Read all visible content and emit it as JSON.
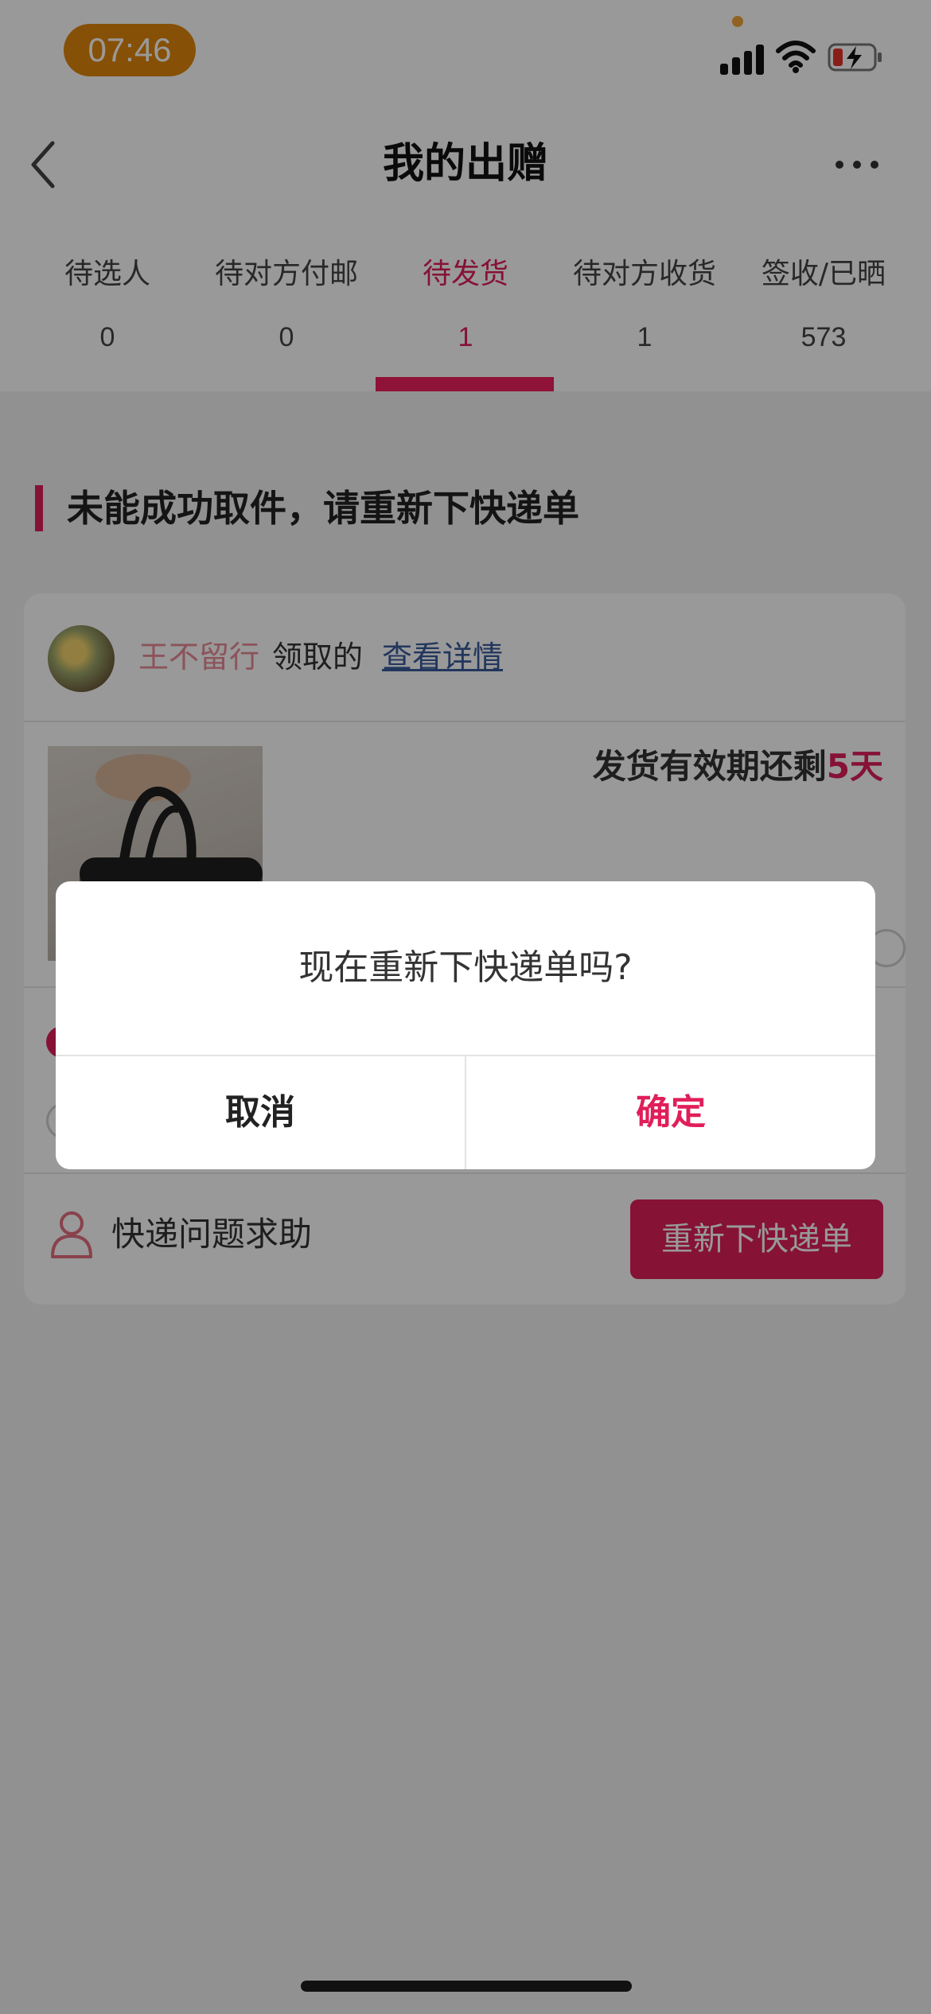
{
  "status_bar": {
    "time": "07:46",
    "icons": [
      "signal-icon",
      "wifi-icon",
      "battery-charging-icon"
    ]
  },
  "header": {
    "title": "我的出赠",
    "back_icon": "chevron-left-icon",
    "more_icon": "more-horizontal-icon"
  },
  "tabs": [
    {
      "label": "待选人",
      "count": "0",
      "active": false
    },
    {
      "label": "待对方付邮",
      "count": "0",
      "active": false
    },
    {
      "label": "待发货",
      "count": "1",
      "active": true
    },
    {
      "label": "待对方收货",
      "count": "1",
      "active": false
    },
    {
      "label": "签收/已晒",
      "count": "573",
      "active": false
    }
  ],
  "section": {
    "title": "未能成功取件，请重新下快递单"
  },
  "card": {
    "giver_name": "王不留行",
    "receive_text": "领取的",
    "detail_link": "查看详情",
    "deadline_prefix": "发货有效期还剩",
    "deadline_days": "5天",
    "help_text": "快递问题求助",
    "reorder_button": "重新下快递单"
  },
  "dialog": {
    "message": "现在重新下快递单吗?",
    "cancel": "取消",
    "confirm": "确定"
  },
  "colors": {
    "accent": "#e01e5a",
    "time_pill": "#e0860a",
    "link": "#3a5a9b"
  }
}
